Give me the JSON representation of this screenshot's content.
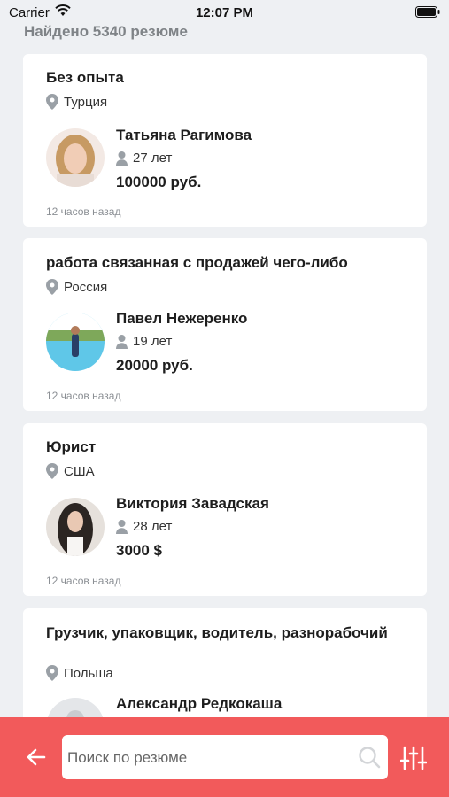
{
  "status": {
    "carrier": "Carrier",
    "time": "12:07 PM"
  },
  "results_count": "Найдено 5340 резюме",
  "cards": [
    {
      "title": "Без опыта",
      "location": "Турция",
      "name": "Татьяна Рагимова",
      "age": "27 лет",
      "salary": "100000 руб.",
      "time_ago": "12 часов назад"
    },
    {
      "title": "работа связанная с продажей чего-либо",
      "location": "Россия",
      "name": "Павел Нежеренко",
      "age": "19 лет",
      "salary": "20000 руб.",
      "time_ago": "12 часов назад"
    },
    {
      "title": "Юрист",
      "location": "США",
      "name": "Виктория  Завадская",
      "age": "28  лет",
      "salary": "3000 $",
      "time_ago": "12 часов назад"
    },
    {
      "title": "Грузчик, упаковщик, водитель, разнорабочий",
      "location": "Польша",
      "name": "Александр Редкокаша"
    }
  ],
  "search": {
    "placeholder": "Поиск по резюме"
  },
  "colors": {
    "accent": "#f25a5b",
    "background": "#eef0f3",
    "muted": "#8b8f94"
  }
}
